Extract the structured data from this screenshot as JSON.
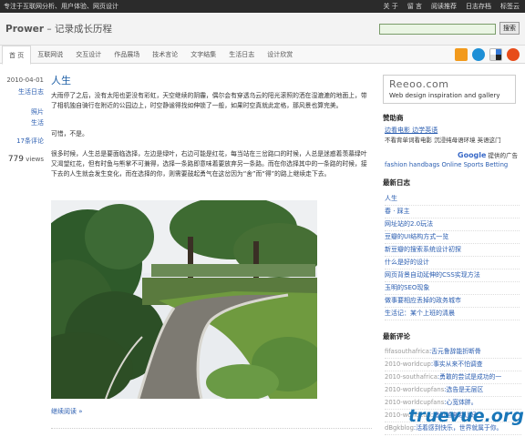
{
  "topbar": {
    "tagline": "专注于互联网分析、用户体验、网页设计",
    "links": [
      "关 于",
      "留 言",
      "阅读推荐",
      "日志存档",
      "标签云"
    ]
  },
  "header": {
    "site_name": "Prower",
    "site_sub": " – 记录成长历程",
    "search_button": "搜索"
  },
  "nav": {
    "items": [
      "首 页",
      "互联网说",
      "交互设计",
      "作品展场",
      "技术言论",
      "文字结集",
      "生活日志",
      "设计欣赏"
    ]
  },
  "post": {
    "date": "2010-04-01",
    "category": "生活日志",
    "tags": [
      "照片",
      "生活"
    ],
    "comments": "17条评论",
    "views_num": "779",
    "views_label": " views",
    "title": "人生",
    "p1": "大雨停了之后，没有太阳也更没有彩虹，天空继续的阴霾，偶尔会有穿透乌云的阳光滚照的洒在湿漉漉的地面上，带了相机独自骑行在附近的公园边上，时空静谧得找如伸锁了一般，如果时空真就此定格，那风景也算完美。",
    "p2": "可惜，不是。",
    "p3": "很多时候，人生总是要面临选择，左边是绿叶，右边可能是红花，每当站在三岔路口的时候，人总是迷惑着羡慕绿叶又渴望红花，但有时鱼与熊掌不可兼得，选择一条路即意味着要放弃另一条路。而在你选择其中的一条路的时候，接下去的人生就会发生变化，而在选择的你，则需要鼓起勇气在这岔因为“舍”而“得”的路上继续走下去。",
    "read_more": "继续阅读 »"
  },
  "sidebar": {
    "ad_logo": "Reeoo.com",
    "ad_tagline": "Web design inspiration and gallery",
    "sponsor_title": "赞助商",
    "sponsor_link": "边看电影 边学英语",
    "sponsor_text": "不看背单词看电影 沉浸纯母语环境 英语这门",
    "google_label": "Google",
    "google_sub": " 提供的广告",
    "sponsor_ad": "fashion handbags Online Sports Betting",
    "recent_title": "最新日志",
    "recent": [
      "人生",
      "春 · 踩主",
      "网址站的2.0玩法",
      "豆瓣的UI结构方式一览",
      "新豆瓣的搜索系统设计初探",
      "什么是好的设计",
      "网页背景自动延伸的CSS实现方法",
      "玉明的SEO现象",
      "做事要相应丢掉的政务城市",
      "生活记：某个上班的清晨"
    ],
    "comments_title": "最新评论",
    "comments": [
      {
        "who": "fifasouthafrica",
        "what": ":舌元鲁辞能折断骨"
      },
      {
        "who": "2010-worldcup",
        "what": ":事实从来不怕调查"
      },
      {
        "who": "2010-southafrica",
        "what": ":勇敢的尝试是成功的一"
      },
      {
        "who": "2010-worldcupfans",
        "what": ":选告是无层区"
      },
      {
        "who": "2010-worldcupfans",
        "what": ":心宽体胖。"
      },
      {
        "who": "2010-worldcup",
        "what": ":赌风越来越让好"
      },
      {
        "who": "dBgkblog",
        "what": ":活着感到快乐，世界就属于你。"
      }
    ]
  },
  "watermark": "truevue.org",
  "colors": {
    "link": "#2a5db0",
    "title": "#1d5fa6",
    "topbar": "#2b2b2b"
  }
}
